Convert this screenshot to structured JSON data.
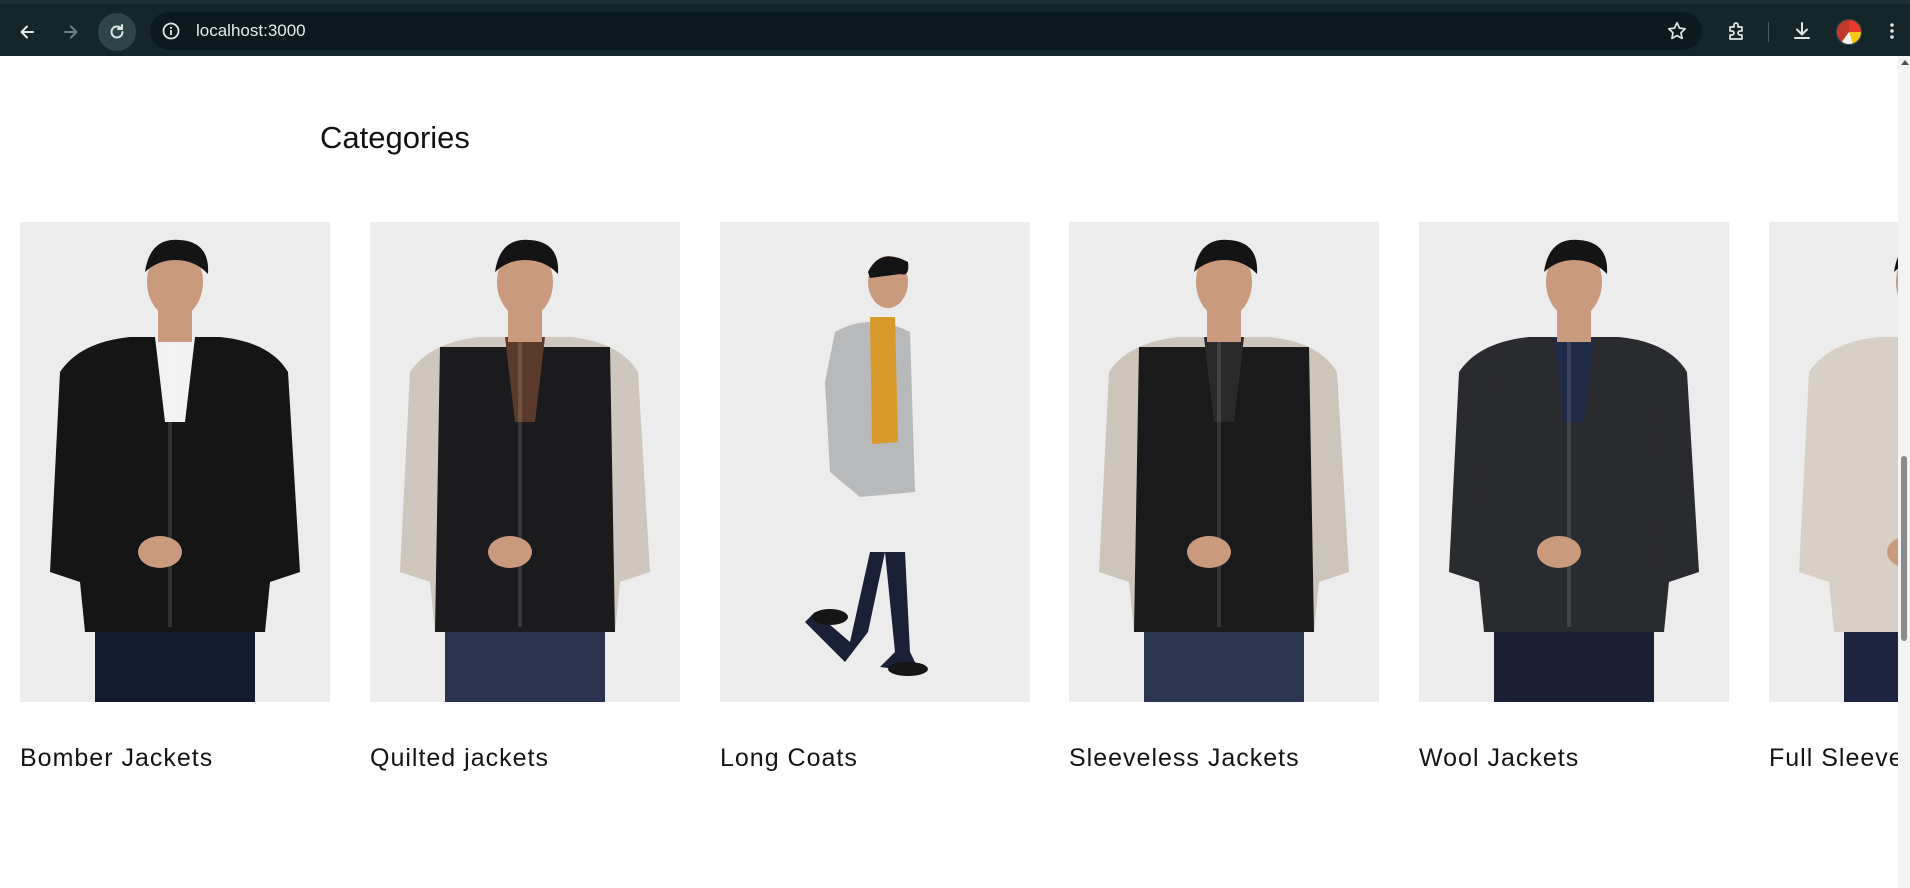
{
  "browser": {
    "url": "localhost:3000",
    "icons": {
      "back": "arrow-left-icon",
      "forward": "arrow-right-icon",
      "reload": "reload-icon",
      "site_info": "info-icon",
      "bookmark": "star-icon",
      "extensions": "puzzle-icon",
      "downloads": "download-icon",
      "menu": "kebab-menu-icon"
    }
  },
  "section": {
    "title": "Categories"
  },
  "categories": [
    {
      "label": "Bomber Jackets",
      "garment_color": "#151515",
      "sleeve_color": "#151515",
      "inner_color": "#f2f2f2",
      "pants_color": "#141a2e"
    },
    {
      "label": "Quilted jackets",
      "garment_color": "#1b1b1d",
      "sleeve_color": "#cfc6bd",
      "inner_color": "#5a3a2a",
      "pants_color": "#2a3350"
    },
    {
      "label": "Long Coats",
      "garment_color": "#b8b9ba",
      "sleeve_color": "#b8b9ba",
      "inner_color": "#d99a2b",
      "pants_color": "#1a2036"
    },
    {
      "label": "Sleeveless Jackets",
      "garment_color": "#1a1a1a",
      "sleeve_color": "#cdc4ba",
      "inner_color": "#2a2a2a",
      "pants_color": "#2c3650"
    },
    {
      "label": "Wool Jackets",
      "garment_color": "#2a2b2e",
      "sleeve_color": "#2a2b2e",
      "inner_color": "#1e2a48",
      "pants_color": "#1a1f33"
    },
    {
      "label": "Full Sleeve",
      "garment_color": "#d8d0c6",
      "sleeve_color": "#d8d0c6",
      "inner_color": "#d8d0c6",
      "pants_color": "#1d2540"
    }
  ],
  "colors": {
    "chrome_bg": "#15262b",
    "omnibox_bg": "#0b1a1e",
    "image_bg": "#ececed",
    "skin": "#c99a7e",
    "hair": "#141414"
  }
}
